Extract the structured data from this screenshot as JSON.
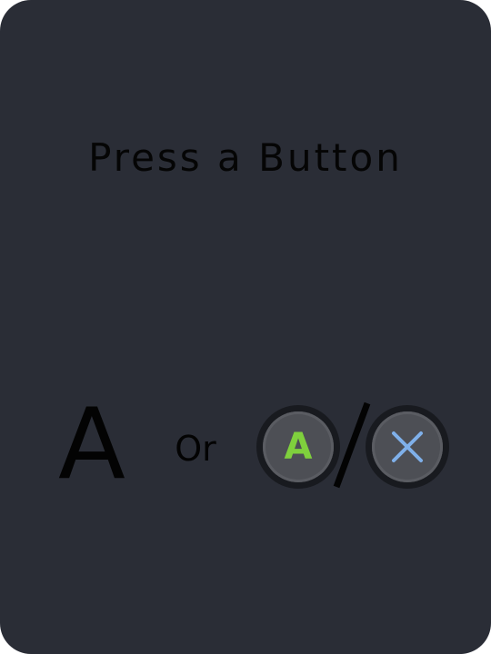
{
  "prompt": {
    "title": "Press a Button",
    "keyboard_key": "A",
    "connector": "Or",
    "gamepad_a_label": "A",
    "gamepad_a_color": "#7fd03d",
    "gamepad_x_icon": "cross-icon",
    "gamepad_x_color": "#7fb0ea",
    "separator": "/"
  },
  "colors": {
    "card_background": "#2a2d36",
    "text": "#050505",
    "button_face": "#4d4f55",
    "button_rim": "#181a1f"
  }
}
